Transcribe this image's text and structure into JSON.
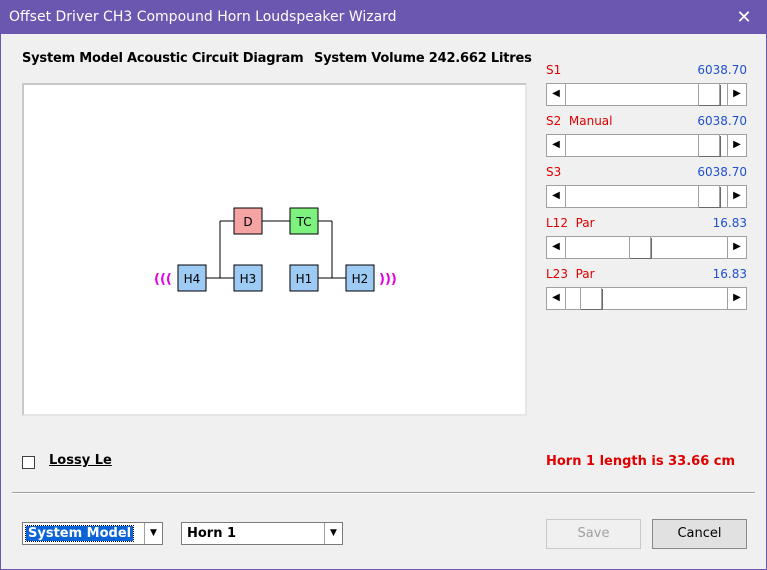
{
  "window": {
    "title": "Offset Driver CH3 Compound Horn Loudspeaker Wizard"
  },
  "header": {
    "diagram_title": "System Model Acoustic Circuit Diagram",
    "volume_text": "System Volume 242.662 Litres"
  },
  "diagram": {
    "boxes": [
      {
        "id": "h4",
        "label": "H4",
        "color": "#9ecbf3"
      },
      {
        "id": "h3",
        "label": "H3",
        "color": "#9ecbf3"
      },
      {
        "id": "h1",
        "label": "H1",
        "color": "#9ecbf3"
      },
      {
        "id": "h2",
        "label": "H2",
        "color": "#9ecbf3"
      },
      {
        "id": "d",
        "label": "D",
        "color": "#f5a3a3"
      },
      {
        "id": "tc",
        "label": "TC",
        "color": "#7ef27e"
      }
    ],
    "left_mark": "(((",
    "right_mark": ")))",
    "mark_color": "#e000e0"
  },
  "sliders": [
    {
      "label": "S1",
      "value": "6038.70",
      "position": 0.95
    },
    {
      "label": "S2  Manual",
      "value": "6038.70",
      "position": 0.95
    },
    {
      "label": "S3",
      "value": "6038.70",
      "position": 0.95
    },
    {
      "label": "L12  Par",
      "value": "16.83",
      "position": 0.45
    },
    {
      "label": "L23  Par",
      "value": "16.83",
      "position": 0.1
    }
  ],
  "options": {
    "lossy_label": "Lossy Le",
    "lossy_checked": false
  },
  "status": {
    "horn_length": "Horn 1 length is 33.66 cm"
  },
  "footer": {
    "model_select": "System Model",
    "horn_select": "Horn 1",
    "save_label": "Save",
    "cancel_label": "Cancel"
  },
  "colors": {
    "titlebar": "#6b56b0",
    "label_red": "#e00000",
    "value_blue": "#1d50d0"
  }
}
